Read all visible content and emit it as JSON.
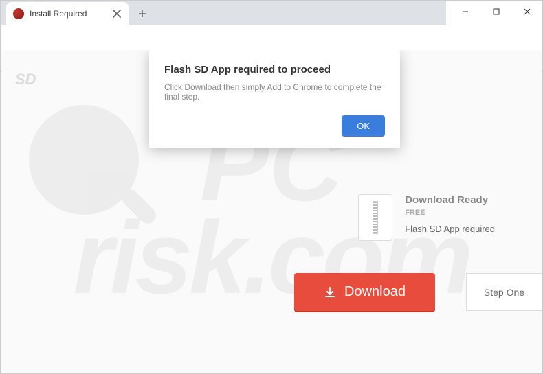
{
  "window": {
    "tab_title": "Install Required"
  },
  "modal": {
    "title": "Flash SD App required to proceed",
    "text": "Click Download then simply Add to Chrome to complete the final step.",
    "ok_label": "OK"
  },
  "page": {
    "sd_badge": "SD",
    "download_ready": "Download Ready",
    "free_label": "FREE",
    "app_required": "Flash SD App required",
    "download_btn": "Download",
    "step_one": "Step One"
  },
  "watermark": {
    "line1": "PC",
    "line2": "risk.com"
  }
}
